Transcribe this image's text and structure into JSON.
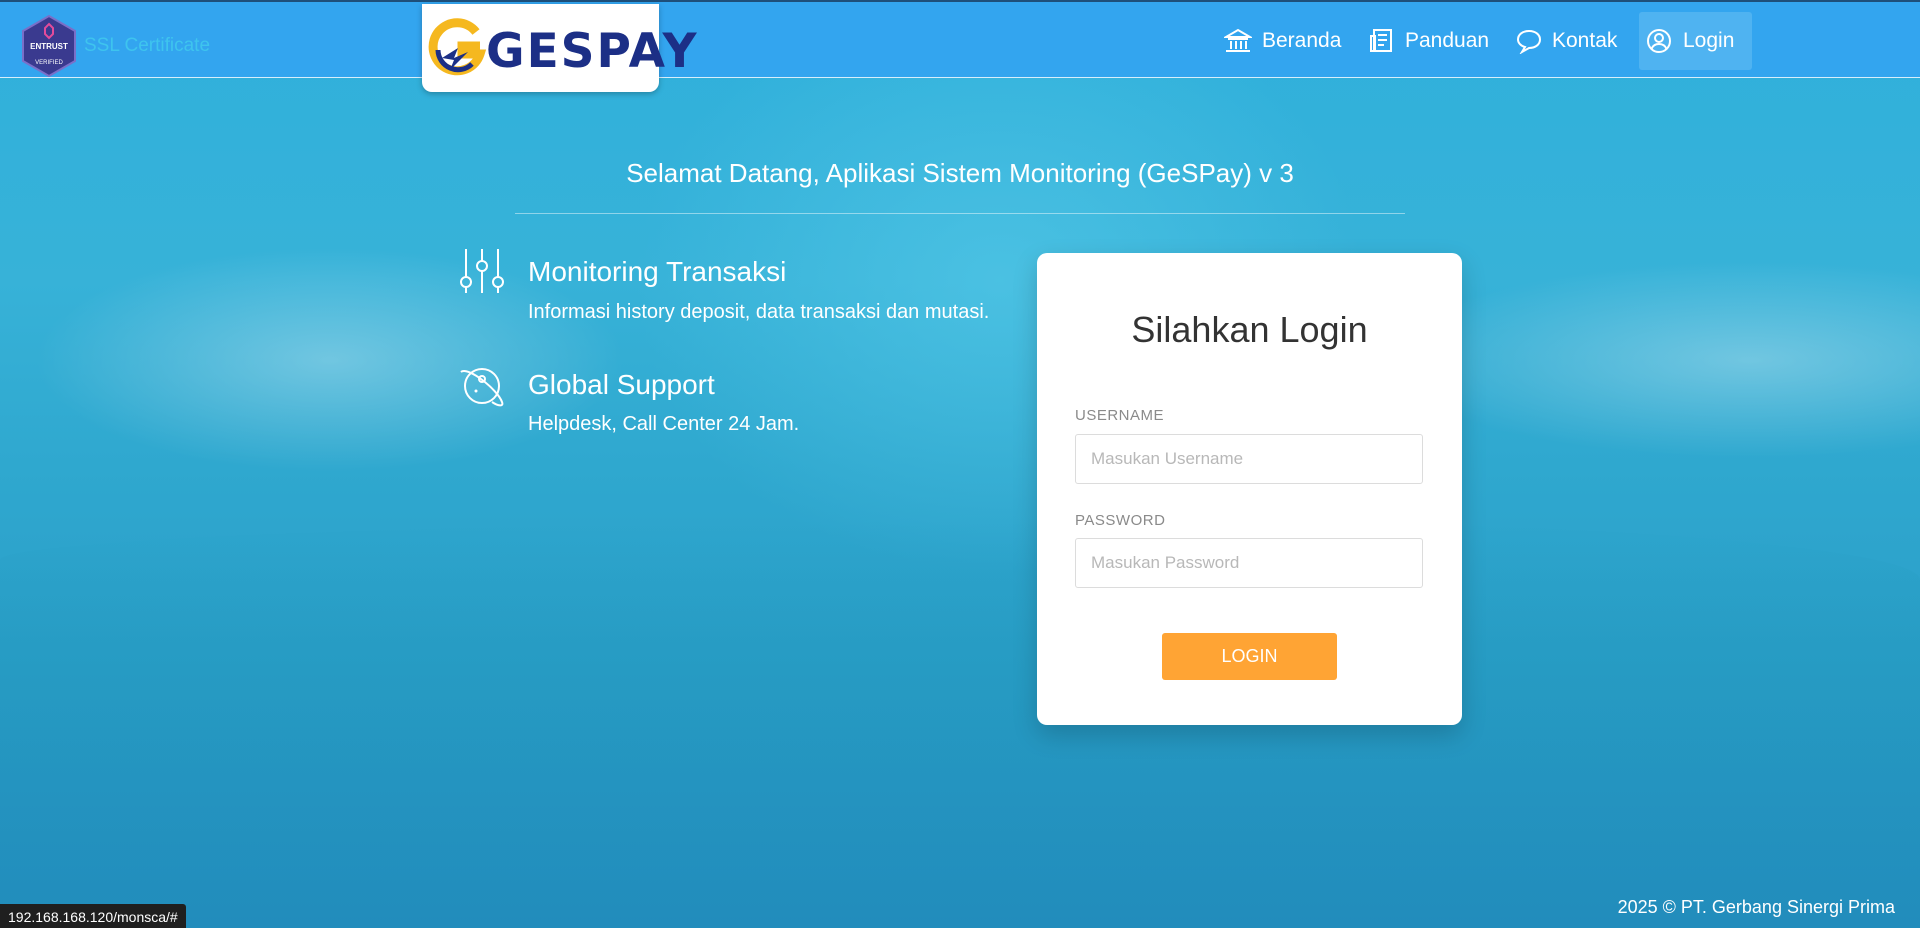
{
  "header": {
    "ssl_label": "SSL Certificate",
    "ssl_badge_text": "ENTRUST",
    "ssl_badge_sub": "VERIFIED",
    "logo_text": "GESPAY",
    "nav": [
      {
        "label": "Beranda",
        "icon": "bank-icon"
      },
      {
        "label": "Panduan",
        "icon": "document-icon"
      },
      {
        "label": "Kontak",
        "icon": "chat-bubble-icon"
      },
      {
        "label": "Login",
        "icon": "user-circle-icon",
        "active": true
      }
    ]
  },
  "main": {
    "welcome": "Selamat Datang, Aplikasi Sistem Monitoring (GeSPay) v 3",
    "features": [
      {
        "title": "Monitoring Transaksi",
        "desc": "Informasi history deposit, data transaksi dan mutasi.",
        "icon": "sliders-icon"
      },
      {
        "title": "Global Support",
        "desc": "Helpdesk, Call Center 24 Jam.",
        "icon": "planet-icon"
      }
    ]
  },
  "login": {
    "title": "Silahkan Login",
    "username_label": "USERNAME",
    "username_placeholder": "Masukan Username",
    "username_value": "",
    "password_label": "PASSWORD",
    "password_placeholder": "Masukan Password",
    "password_value": "",
    "button_label": "LOGIN"
  },
  "footer": {
    "copyright": "2025 © PT. Gerbang Sinergi Prima"
  },
  "status_bar": {
    "url": "192.168.168.120/monsca/#"
  },
  "colors": {
    "navbar": "#33a5ef",
    "accent_button": "#ffa434",
    "logo_text": "#1c2f86"
  }
}
